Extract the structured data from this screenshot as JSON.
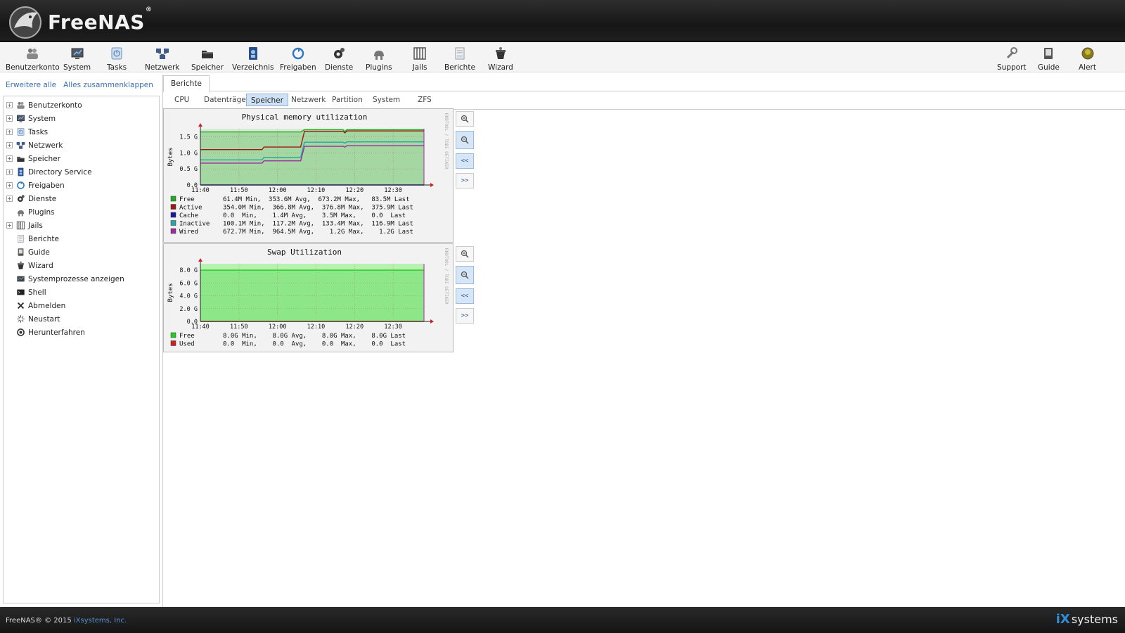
{
  "app": {
    "logo_text": "FreeNAS",
    "logo_reg": "®"
  },
  "toolbar": {
    "items": [
      {
        "label": "Benutzerkonto",
        "icon": "users-icon"
      },
      {
        "label": "System",
        "icon": "system-icon"
      },
      {
        "label": "Tasks",
        "icon": "tasks-icon"
      },
      {
        "label": "Netzwerk",
        "icon": "network-icon"
      },
      {
        "label": "Speicher",
        "icon": "storage-icon"
      },
      {
        "label": "Verzeichnis",
        "icon": "directory-icon"
      },
      {
        "label": "Freigaben",
        "icon": "sharing-icon"
      },
      {
        "label": "Dienste",
        "icon": "services-icon"
      },
      {
        "label": "Plugins",
        "icon": "plugins-icon"
      },
      {
        "label": "Jails",
        "icon": "jails-icon"
      },
      {
        "label": "Berichte",
        "icon": "reports-icon"
      },
      {
        "label": "Wizard",
        "icon": "wizard-icon"
      }
    ],
    "right_items": [
      {
        "label": "Support",
        "icon": "support-icon"
      },
      {
        "label": "Guide",
        "icon": "guide-icon"
      },
      {
        "label": "Alert",
        "icon": "alert-icon"
      }
    ]
  },
  "sidebar": {
    "expand_all": "Erweitere alle",
    "collapse_all": "Alles zusammenklappen",
    "items": [
      {
        "label": "Benutzerkonto",
        "expandable": true
      },
      {
        "label": "System",
        "expandable": true
      },
      {
        "label": "Tasks",
        "expandable": true
      },
      {
        "label": "Netzwerk",
        "expandable": true
      },
      {
        "label": "Speicher",
        "expandable": true
      },
      {
        "label": "Directory Service",
        "expandable": true
      },
      {
        "label": "Freigaben",
        "expandable": true
      },
      {
        "label": "Dienste",
        "expandable": true
      },
      {
        "label": "Plugins",
        "expandable": false
      },
      {
        "label": "Jails",
        "expandable": true
      },
      {
        "label": "Berichte",
        "expandable": false
      },
      {
        "label": "Guide",
        "expandable": false
      },
      {
        "label": "Wizard",
        "expandable": false
      },
      {
        "label": "Systemprozesse anzeigen",
        "expandable": false
      },
      {
        "label": "Shell",
        "expandable": false
      },
      {
        "label": "Abmelden",
        "expandable": false
      },
      {
        "label": "Neustart",
        "expandable": false
      },
      {
        "label": "Herunterfahren",
        "expandable": false
      }
    ]
  },
  "main": {
    "tab": "Berichte",
    "subtabs": [
      "CPU",
      "Datenträger",
      "Speicher",
      "Netzwerk",
      "Partition",
      "System",
      "ZFS"
    ],
    "active_subtab": "Speicher",
    "graph_buttons": [
      "<<",
      ">>"
    ]
  },
  "chart_data": [
    {
      "type": "area",
      "title": "Physical memory utilization",
      "ylabel": "Bytes",
      "side_label": "RRDTOOL / TOBI OETIKER",
      "ylim": [
        0,
        1.75
      ],
      "yticks": [
        "0.0",
        "0.5 G",
        "1.0 G",
        "1.5 G"
      ],
      "ytick_values": [
        0,
        0.5,
        1.0,
        1.5
      ],
      "xticks": [
        "11:40",
        "11:50",
        "12:00",
        "12:10",
        "12:20",
        "12:30"
      ],
      "xtick_values": [
        0,
        10,
        20,
        30,
        40,
        50
      ],
      "xlim": [
        0,
        58
      ],
      "series": [
        {
          "name": "Free",
          "color": "#22aa22",
          "stats": "61.4M Min,  353.6M Avg,  673.2M Max,   83.5M Last",
          "x": [
            0,
            16,
            16.5,
            26,
            27,
            37,
            37.5,
            38,
            58
          ],
          "values": [
            1.65,
            1.65,
            1.65,
            1.65,
            1.72,
            1.72,
            1.66,
            1.72,
            1.72
          ]
        },
        {
          "name": "Active",
          "color": "#a01818",
          "stats": "354.0M Min,  366.8M Avg,  376.8M Max,  375.9M Last",
          "x": [
            0,
            16,
            16.5,
            26,
            27,
            37,
            37.5,
            38,
            58
          ],
          "values": [
            1.1,
            1.1,
            1.18,
            1.18,
            1.67,
            1.67,
            1.62,
            1.68,
            1.68
          ]
        },
        {
          "name": "Cache",
          "color": "#1a1a9e",
          "stats": "0.0  Min,    1.4M Avg,    3.5M Max,    0.0  Last",
          "x": [
            0,
            58
          ],
          "values": [
            0.0,
            0.0
          ]
        },
        {
          "name": "Inactive",
          "color": "#2aa6a6",
          "stats": "100.1M Min,  117.2M Avg,  133.4M Max,  116.9M Last",
          "x": [
            0,
            16,
            16.5,
            26,
            27,
            37,
            37.5,
            38,
            58
          ],
          "values": [
            0.78,
            0.78,
            0.86,
            0.86,
            1.33,
            1.33,
            1.3,
            1.34,
            1.34
          ]
        },
        {
          "name": "Wired",
          "color": "#a02aa0",
          "stats": "672.7M Min,  964.5M Avg,    1.2G Max,    1.2G Last",
          "x": [
            0,
            16,
            16.5,
            26,
            27,
            37,
            37.5,
            38,
            58
          ],
          "values": [
            0.68,
            0.68,
            0.75,
            0.75,
            1.2,
            1.2,
            1.18,
            1.22,
            1.22
          ]
        }
      ]
    },
    {
      "type": "area",
      "title": "Swap Utilization",
      "ylabel": "Bytes",
      "side_label": "RRDTOOL / TOBI OETIKER",
      "ylim": [
        0,
        9.0
      ],
      "yticks": [
        "0.0",
        "2.0 G",
        "4.0 G",
        "6.0 G",
        "8.0 G"
      ],
      "ytick_values": [
        0,
        2,
        4,
        6,
        8
      ],
      "xticks": [
        "11:40",
        "11:50",
        "12:00",
        "12:10",
        "12:20",
        "12:30"
      ],
      "xtick_values": [
        0,
        10,
        20,
        30,
        40,
        50
      ],
      "xlim": [
        0,
        58
      ],
      "series": [
        {
          "name": "Free",
          "color": "#22cc22",
          "stats": "8.0G Min,    8.0G Avg,    8.0G Max,    8.0G Last",
          "x": [
            0,
            58
          ],
          "values": [
            8.0,
            8.0
          ]
        },
        {
          "name": "Used",
          "color": "#cc2222",
          "stats": "0.0  Min,    0.0  Avg,    0.0  Max,    0.0  Last",
          "x": [
            0,
            58
          ],
          "values": [
            0.0,
            0.0
          ]
        }
      ]
    }
  ],
  "footer": {
    "copyright": "FreeNAS® © 2015 ",
    "company": "iXsystems, Inc.",
    "brand_ix": "iX",
    "brand_rest": "systems"
  }
}
